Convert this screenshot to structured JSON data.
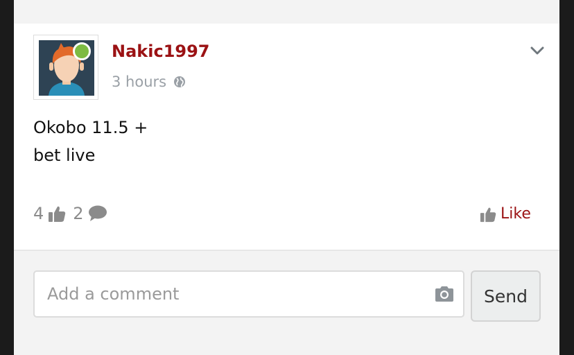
{
  "post": {
    "username": "Nakic1997",
    "time": "3 hours",
    "privacy_icon": "globe-icon",
    "text_lines": [
      "Okobo 11.5 +",
      "bet live"
    ],
    "like_count": "4",
    "comment_count": "2",
    "like_label": "Like"
  },
  "composer": {
    "placeholder": "Add a comment",
    "send_label": "Send"
  },
  "colors": {
    "accent": "#9b1214",
    "online": "#7dbb42"
  }
}
